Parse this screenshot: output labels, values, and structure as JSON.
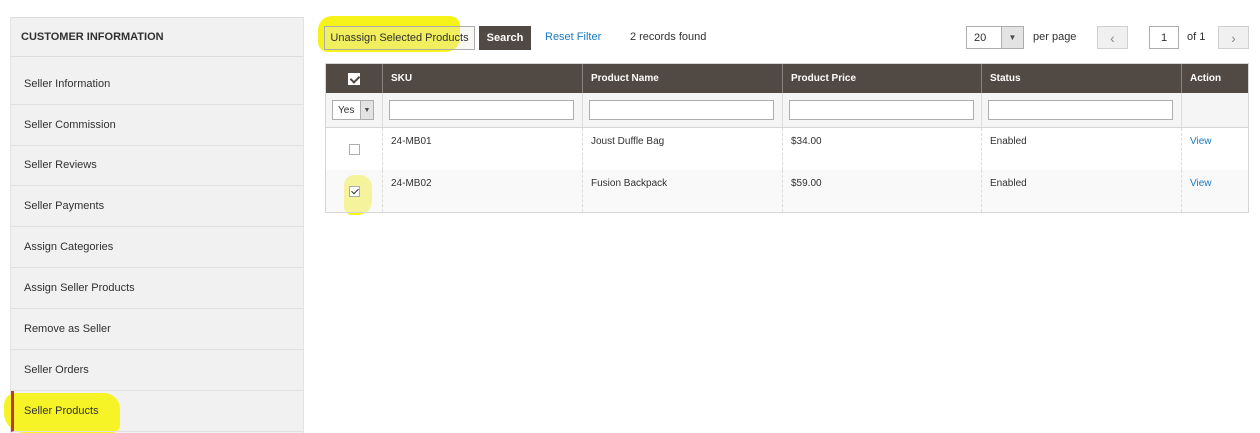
{
  "sidebar": {
    "title": "CUSTOMER INFORMATION",
    "items": [
      {
        "label": "Seller Information"
      },
      {
        "label": "Seller Commission"
      },
      {
        "label": "Seller Reviews"
      },
      {
        "label": "Seller Payments"
      },
      {
        "label": "Assign Categories"
      },
      {
        "label": "Assign Seller Products"
      },
      {
        "label": "Remove as Seller"
      },
      {
        "label": "Seller Orders"
      },
      {
        "label": "Seller Products"
      }
    ],
    "active_item": "Seller Products",
    "accent_color": "#c0392b"
  },
  "toolbar": {
    "unassign_label": "Unassign Selected Products",
    "search_label": "Search",
    "reset_label": "Reset Filter",
    "records_count": "2",
    "records_text": "records found",
    "per_page_value": "20",
    "per_page_label": "per page",
    "prev_icon": "chevron-left-icon",
    "next_icon": "chevron-right-icon",
    "current_page": "1",
    "of_pages": "of 1"
  },
  "grid": {
    "columns": [
      "",
      "SKU",
      "Product Name",
      "Product Price",
      "Status",
      "Action"
    ],
    "filter": {
      "in_products_value": "Yes",
      "sku": "",
      "name": "",
      "price": "",
      "status": ""
    },
    "rows": [
      {
        "checked": false,
        "sku": "24-MB01",
        "name": "Joust Duffle Bag",
        "price": "$34.00",
        "status": "Enabled",
        "action": "View"
      },
      {
        "checked": true,
        "sku": "24-MB02",
        "name": "Fusion Backpack",
        "price": "$59.00",
        "status": "Enabled",
        "action": "View"
      }
    ]
  },
  "colors": {
    "header_bg": "#514943",
    "link": "#1979c3",
    "highlight": "#f5f31a"
  }
}
